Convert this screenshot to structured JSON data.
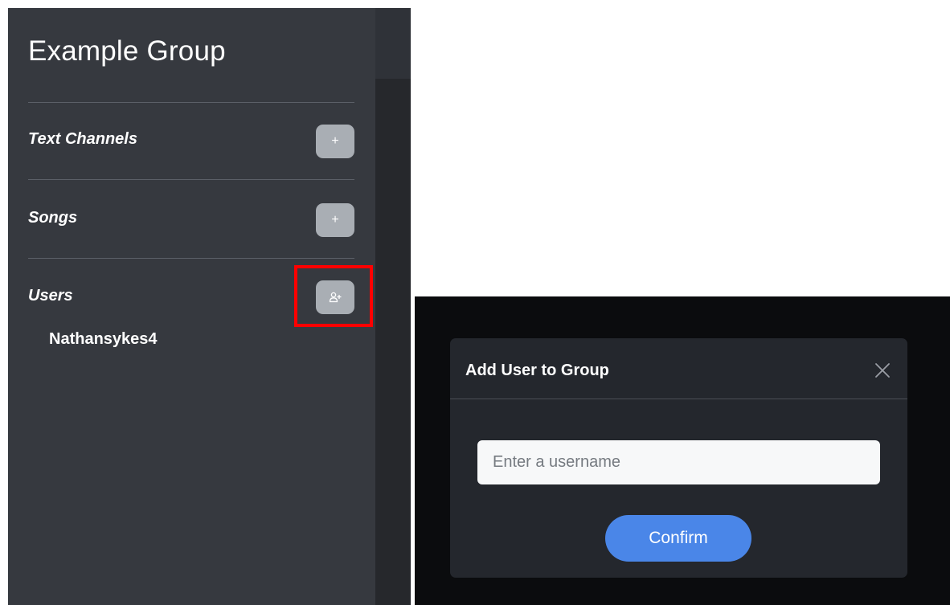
{
  "sidebar": {
    "group_title": "Example Group",
    "sections": [
      {
        "label": "Text Channels",
        "action_icon": "plus-icon"
      },
      {
        "label": "Songs",
        "action_icon": "plus-icon"
      },
      {
        "label": "Users",
        "action_icon": "add-user-icon"
      }
    ],
    "users": [
      "Nathansykes4"
    ],
    "plus_glyph": "+"
  },
  "modal": {
    "title": "Add User to Group",
    "close_icon": "close-icon",
    "input_placeholder": "Enter a username",
    "input_value": "",
    "confirm_label": "Confirm"
  },
  "colors": {
    "sidebar_bg": "#36393f",
    "button_gray": "#a9aeb4",
    "highlight_red": "#ff0000",
    "modal_bg": "#24272d",
    "confirm_blue": "#4a86e8"
  }
}
